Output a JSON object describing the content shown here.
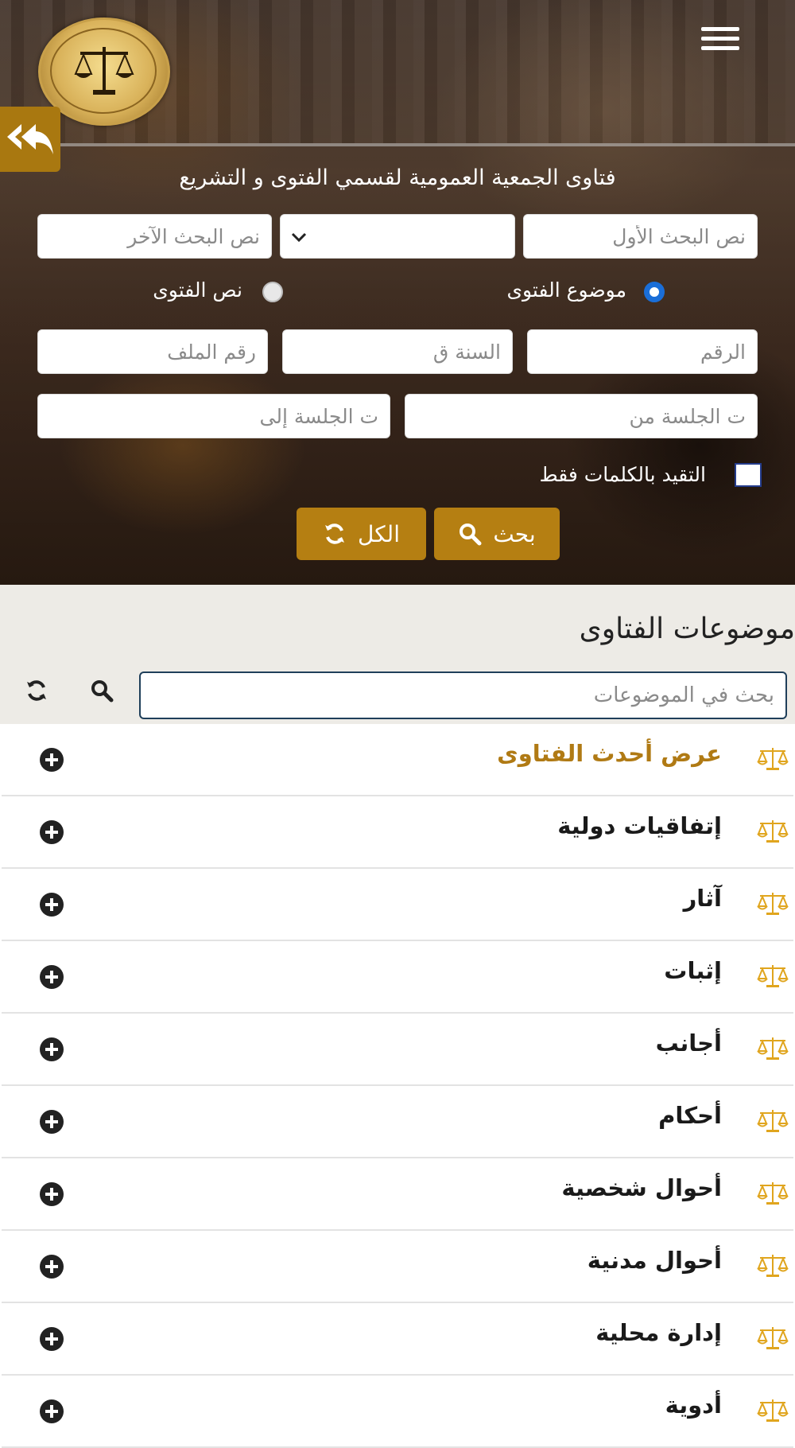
{
  "header": {
    "logo_alt": "مجلس الدولة CONSEIL D'ETAT",
    "menu_icon": "hamburger-menu-icon",
    "back_icon": "reply-all-icon",
    "title": "فتاوى الجمعية العمومية لقسمي الفتوى و التشريع"
  },
  "search_form": {
    "first_text_placeholder": "نص البحث الأول",
    "operator_value": "",
    "other_text_placeholder": "نص البحث الآخر",
    "radio_subject_label": "موضوع الفتوى",
    "radio_text_label": "نص الفتوى",
    "radio_selected": "موضوع الفتوى",
    "number_placeholder": "الرقم",
    "year_placeholder": "السنة ق",
    "file_number_placeholder": "رقم الملف",
    "session_from_placeholder": "ت الجلسة من",
    "session_to_placeholder": "ت الجلسة إلى",
    "exact_words_label": "التقيد بالكلمات فقط",
    "exact_words_checked": false,
    "search_button": "بحث",
    "all_button": "الكل"
  },
  "topics": {
    "title": "موضوعات الفتاوى",
    "search_placeholder": "بحث في الموضوعات",
    "items": [
      {
        "label": "عرض أحدث الفتاوى",
        "highlight": true
      },
      {
        "label": "إتفاقيات دولية",
        "highlight": false
      },
      {
        "label": "آثار",
        "highlight": false
      },
      {
        "label": "إثبات",
        "highlight": false
      },
      {
        "label": "أجانب",
        "highlight": false
      },
      {
        "label": "أحكام",
        "highlight": false
      },
      {
        "label": "أحوال شخصية",
        "highlight": false
      },
      {
        "label": "أحوال مدنية",
        "highlight": false
      },
      {
        "label": "إدارة محلية",
        "highlight": false
      },
      {
        "label": "أدوية",
        "highlight": false
      }
    ]
  },
  "colors": {
    "gold": "#b57f12",
    "radio_blue": "#1a6ed8",
    "topics_bg": "#edebe6",
    "scale_icon": "#e0a51e"
  }
}
